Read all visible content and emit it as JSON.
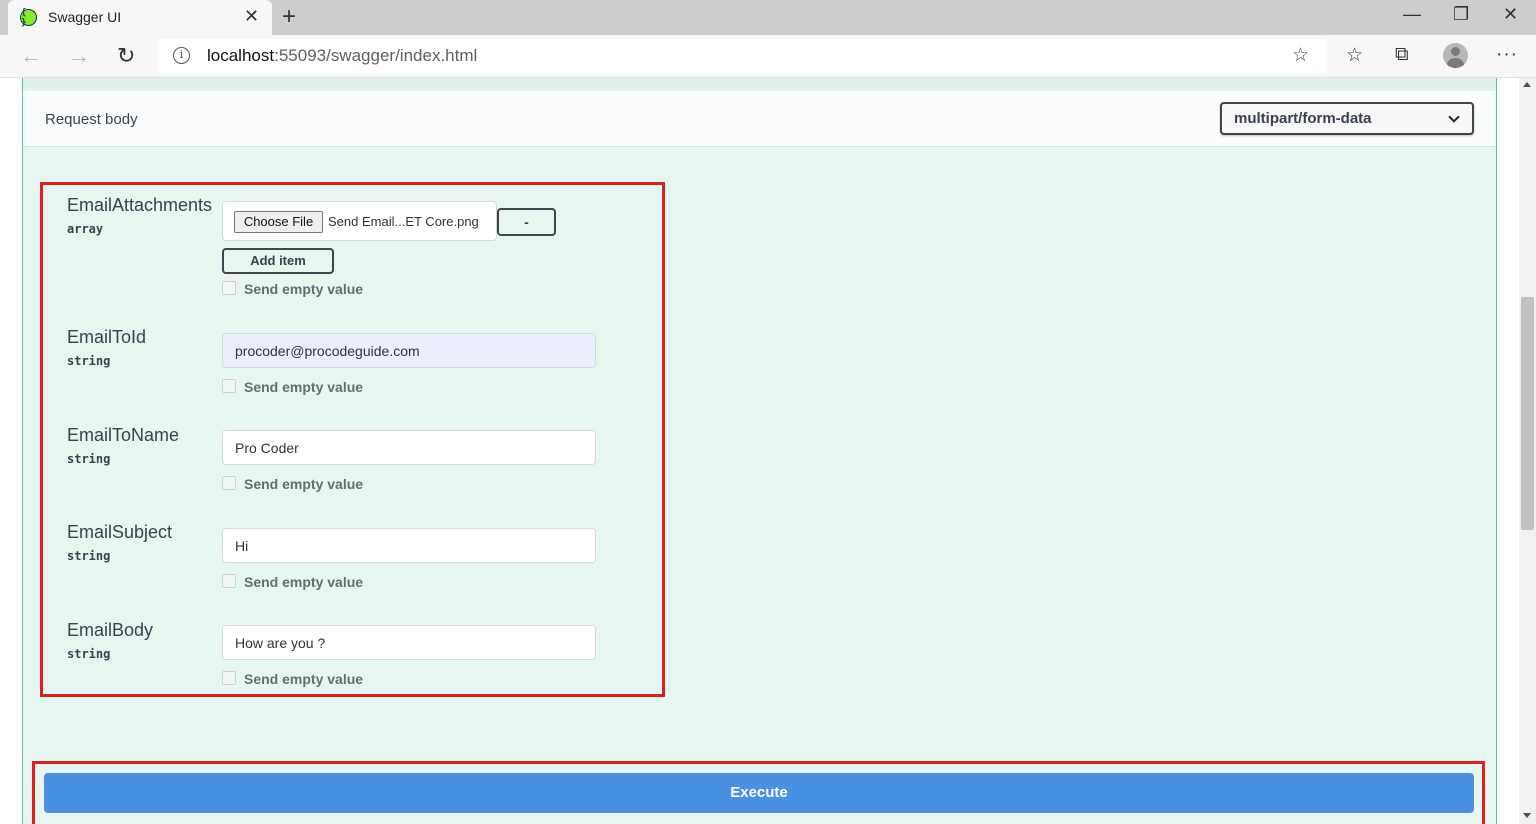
{
  "browser": {
    "tab_title": "Swagger UI",
    "tab_favicon": "{ }",
    "tab_close": "✕",
    "new_tab": "+",
    "url_host": "localhost",
    "url_rest": ":55093/swagger/index.html",
    "info_glyph": "i",
    "icons": [
      "back-arrow-icon",
      "forward-arrow-icon",
      "refresh-icon",
      "info-icon",
      "add-favorite-icon",
      "favorites-icon",
      "collections-icon",
      "profile-avatar",
      "more-icon"
    ]
  },
  "request_body": {
    "title": "Request body",
    "content_type": "multipart/form-data"
  },
  "params": [
    {
      "name": "EmailAttachments",
      "type": "array",
      "choose_file": "Choose File",
      "file_name": "Send Email...ET Core.png",
      "remove_label": "-",
      "add_item_label": "Add item",
      "empty_label": "Send empty value"
    },
    {
      "name": "EmailToId",
      "type": "string",
      "value": "procoder@procodeguide.com",
      "empty_label": "Send empty value"
    },
    {
      "name": "EmailToName",
      "type": "string",
      "value": "Pro Coder",
      "empty_label": "Send empty value"
    },
    {
      "name": "EmailSubject",
      "type": "string",
      "value": "Hi",
      "empty_label": "Send empty value"
    },
    {
      "name": "EmailBody",
      "type": "string",
      "value": "How are you ?",
      "empty_label": "Send empty value"
    }
  ],
  "execute_label": "Execute",
  "colors": {
    "accent": "#4990e2",
    "highlight": "#e0201b",
    "post_bg": "#e8f6f0",
    "post_border": "#49cc90"
  }
}
